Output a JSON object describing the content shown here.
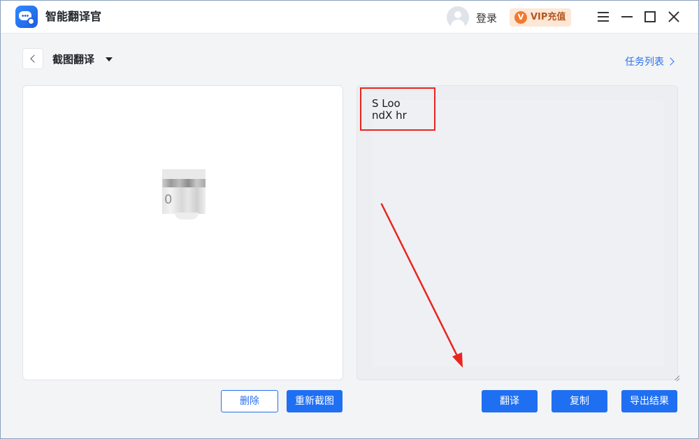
{
  "app": {
    "title": "智能翻译官"
  },
  "titlebar": {
    "login_label": "登录",
    "vip": {
      "icon_letter": "V",
      "label": "VIP充值"
    }
  },
  "header": {
    "mode_label": "截图翻译",
    "task_list_label": "任务列表"
  },
  "source_panel": {
    "thumbnail_text": "0"
  },
  "result_panel": {
    "ocr_lines": [
      "S Loo",
      "ndX hr"
    ]
  },
  "buttons": {
    "delete": "删除",
    "recapture": "重新截图",
    "translate": "翻译",
    "copy": "复制",
    "export": "导出结果"
  },
  "colors": {
    "accent": "#1f6ff2",
    "annotation": "#e8251f",
    "vip_bg": "#fde7d6"
  },
  "icons": [
    "app-logo-icon",
    "avatar-icon",
    "vip-icon",
    "menu-icon",
    "minimize-icon",
    "maximize-icon",
    "close-icon",
    "back-icon",
    "caret-down-icon",
    "chevron-right-icon",
    "resize-grip-icon",
    "arrow-annotation"
  ]
}
